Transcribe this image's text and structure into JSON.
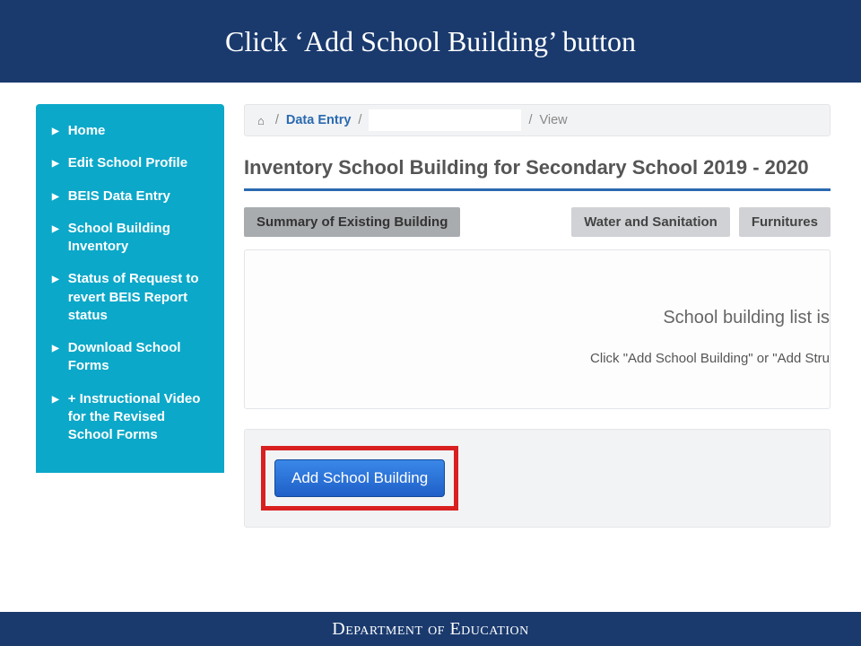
{
  "banner": {
    "title": "Click ‘Add School Building’ button"
  },
  "sidebar": {
    "items": [
      {
        "label": "Home"
      },
      {
        "label": "Edit School Profile"
      },
      {
        "label": "BEIS Data Entry"
      },
      {
        "label": "School Building Inventory"
      },
      {
        "label": "Status of Request to revert BEIS Report status"
      },
      {
        "label": "Download School Forms"
      },
      {
        "label": "+ Instructional Video for the Revised School Forms"
      }
    ]
  },
  "breadcrumb": {
    "home_icon": "⌂",
    "sep": "/",
    "data_entry": "Data Entry",
    "view": "View"
  },
  "page": {
    "title": "Inventory School Building for Secondary School 2019 - 2020"
  },
  "tabs": {
    "summary": "Summary of Existing Building",
    "water": "Water and Sanitation",
    "furnitures": "Furnitures"
  },
  "panel": {
    "msg1": "School building list is",
    "msg2": "Click \"Add School Building\" or \"Add Stru"
  },
  "actions": {
    "add_label": "Add School Building"
  },
  "footer": {
    "label": "Department of Education"
  }
}
